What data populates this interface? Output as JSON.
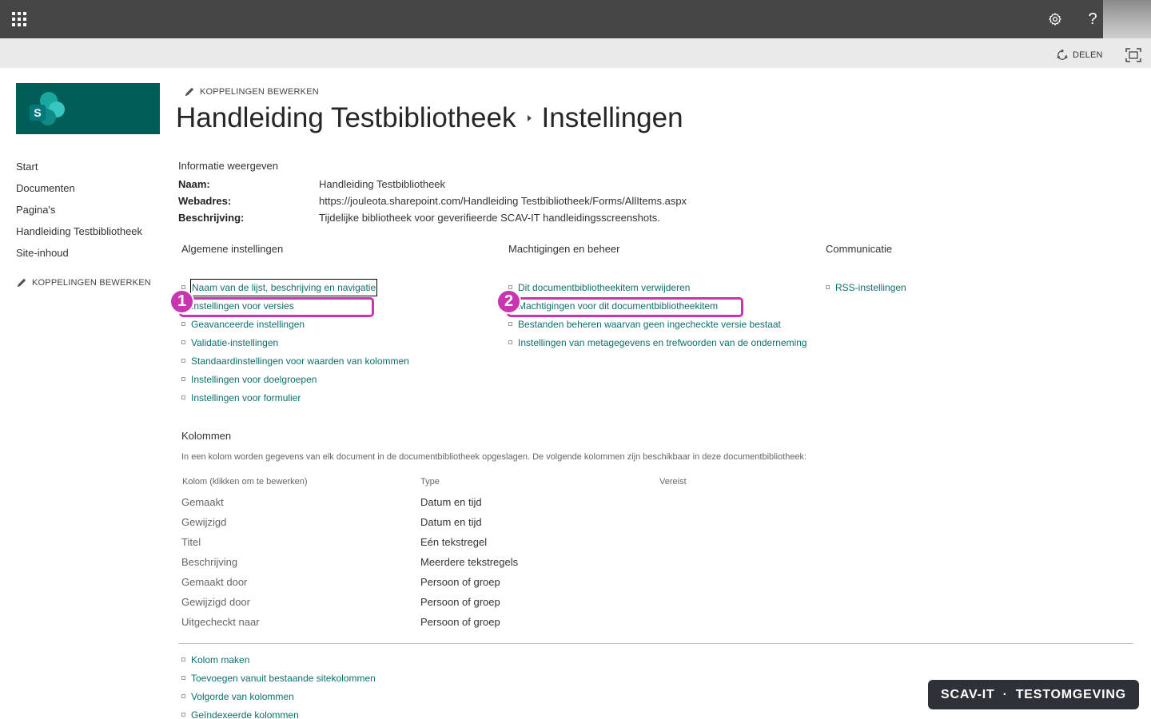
{
  "suitebar": {
    "app_launcher_icon": "waffle-icon",
    "settings_icon": "gear-icon",
    "help_label": "?"
  },
  "commandbar": {
    "share_label": "DELEN",
    "share_icon": "share-icon",
    "focus_icon": "focus-mode-icon"
  },
  "site": {
    "logo_letter": "S",
    "colors": {
      "logo_bg": "#005e57",
      "link": "#0f6e6e",
      "highlight": "#c935b0",
      "suitebar": "#464646"
    }
  },
  "leftnav": {
    "items": [
      {
        "label": "Start"
      },
      {
        "label": "Documenten"
      },
      {
        "label": "Pagina's"
      },
      {
        "label": "Handleiding Testbibliotheek"
      },
      {
        "label": "Site-inhoud"
      }
    ],
    "edit_links": "KOPPELINGEN BEWERKEN"
  },
  "header": {
    "edit_links": "KOPPELINGEN BEWERKEN",
    "breadcrumb_library": "Handleiding Testbibliotheek",
    "breadcrumb_page": "Instellingen"
  },
  "info": {
    "heading": "Informatie weergeven",
    "name_label": "Naam:",
    "name_value": "Handleiding Testbibliotheek",
    "url_label": "Webadres:",
    "url_value": "https://jouleota.sharepoint.com/Handleiding Testbibliotheek/Forms/AllItems.aspx",
    "desc_label": "Beschrijving:",
    "desc_value": "Tijdelijke bibliotheek voor geverifieerde SCAV-IT handleidingsscreenshots."
  },
  "sections": {
    "general": {
      "title": "Algemene instellingen",
      "links": [
        "Naam van de lijst, beschrijving en navigatie",
        "Instellingen voor versies",
        "Geavanceerde instellingen",
        "Validatie-instellingen",
        "Standaardinstellingen voor waarden van kolommen",
        "Instellingen voor doelgroepen",
        "Instellingen voor formulier"
      ]
    },
    "permissions": {
      "title": "Machtigingen en beheer",
      "links": [
        "Dit documentbibliotheekitem verwijderen",
        "Machtigingen voor dit documentbibliotheekitem",
        "Bestanden beheren waarvan geen ingecheckte versie bestaat",
        "Instellingen van metagegevens en trefwoorden van de onderneming"
      ]
    },
    "communication": {
      "title": "Communicatie",
      "links": [
        "RSS-instellingen"
      ]
    }
  },
  "annotations": {
    "badge1": "1",
    "badge2": "2"
  },
  "columns": {
    "heading": "Kolommen",
    "description": "In een kolom worden gegevens van elk document in de documentbibliotheek opgeslagen. De volgende kolommen zijn beschikbaar in deze documentbibliotheek:",
    "headers": {
      "name": "Kolom (klikken om te bewerken)",
      "type": "Type",
      "required": "Vereist"
    },
    "rows": [
      {
        "name": "Gemaakt",
        "type": "Datum en tijd"
      },
      {
        "name": "Gewijzigd",
        "type": "Datum en tijd"
      },
      {
        "name": "Titel",
        "type": "Eén tekstregel"
      },
      {
        "name": "Beschrijving",
        "type": "Meerdere tekstregels"
      },
      {
        "name": "Gemaakt door",
        "type": "Persoon of groep"
      },
      {
        "name": "Gewijzigd door",
        "type": "Persoon of groep"
      },
      {
        "name": "Uitgecheckt naar",
        "type": "Persoon of groep"
      }
    ],
    "links": [
      "Kolom maken",
      "Toevoegen vanuit bestaande sitekolommen",
      "Volgorde van kolommen",
      "Geïndexeerde kolommen"
    ]
  },
  "env_badge": {
    "left": "SCAV-IT",
    "sep": "·",
    "right": "TESTOMGEVING"
  }
}
